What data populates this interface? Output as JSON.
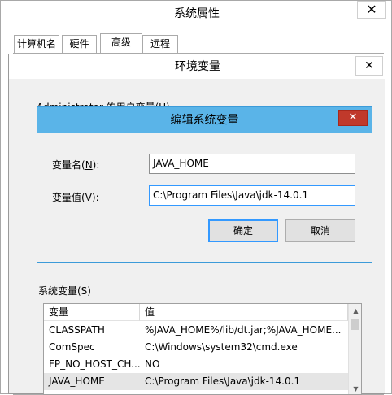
{
  "system_properties": {
    "title": "系统属性",
    "close_label": "✕",
    "tabs": [
      "计算机名",
      "硬件",
      "高级",
      "远程"
    ]
  },
  "env_vars": {
    "title": "环境变量",
    "close_label": "✕",
    "user_vars_label": "Administrator 的用户变量(U)",
    "system_vars_label": "系统变量(S)",
    "columns": [
      "变量",
      "值"
    ],
    "rows": [
      {
        "name": "CLASSPATH",
        "value": "%JAVA_HOME%/lib/dt.jar;%JAVA_HOME..."
      },
      {
        "name": "ComSpec",
        "value": "C:\\Windows\\system32\\cmd.exe"
      },
      {
        "name": "FP_NO_HOST_CH...",
        "value": "NO"
      },
      {
        "name": "JAVA_HOME",
        "value": "C:\\Program Files\\Java\\jdk-14.0.1"
      }
    ]
  },
  "edit_dialog": {
    "title": "编辑系统变量",
    "close_label": "✕",
    "name_label_pre": "变量名(",
    "name_label_key": "N",
    "name_label_post": "):",
    "value_label_pre": "变量值(",
    "value_label_key": "V",
    "value_label_post": "):",
    "name_value": "JAVA_HOME",
    "value_value": "C:\\Program Files\\Java\\jdk-14.0.1",
    "ok_label": "确定",
    "cancel_label": "取消"
  },
  "colors": {
    "dialog_titlebar": "#5ab4e8",
    "close_button": "#c0392b",
    "focus_border": "#3399ff"
  }
}
